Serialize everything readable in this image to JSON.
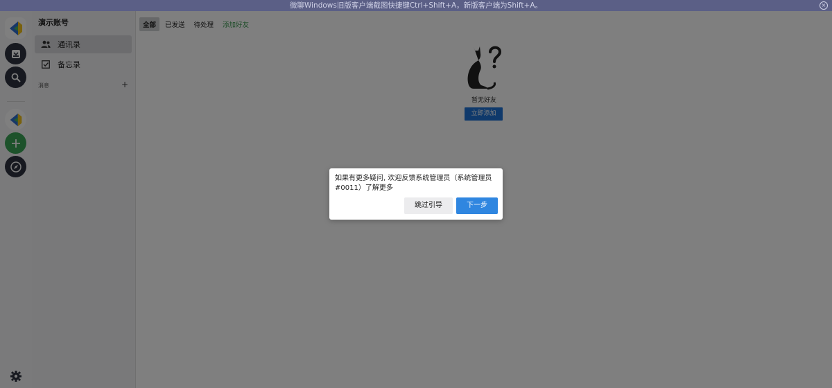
{
  "banner": {
    "text": "微聊Windows旧版客户端截图快捷键Ctrl+Shift+A，新版客户端为Shift+A。",
    "close_icon": "close-icon"
  },
  "rail": {
    "items": [
      {
        "name": "app-logo",
        "icon": "app-logo-icon"
      },
      {
        "name": "inbox",
        "icon": "inbox-icon"
      },
      {
        "name": "search",
        "icon": "search-icon"
      },
      {
        "name": "workspace",
        "icon": "app-logo-icon"
      },
      {
        "name": "add",
        "icon": "plus-icon"
      },
      {
        "name": "discover",
        "icon": "compass-icon"
      },
      {
        "name": "settings",
        "icon": "gear-icon"
      }
    ],
    "colors": {
      "dark_button": "#2f3340",
      "green_button": "#3aa557"
    }
  },
  "panel": {
    "account_title": "演示账号",
    "nav": [
      {
        "label": "通讯录",
        "icon": "contacts-icon",
        "active": true
      },
      {
        "label": "备忘录",
        "icon": "checkbox-icon",
        "active": false
      }
    ],
    "section_label": "消息",
    "section_add": "+"
  },
  "main": {
    "tabs": [
      {
        "label": "全部",
        "active": true
      },
      {
        "label": "已发送",
        "active": false
      },
      {
        "label": "待处理",
        "active": false
      },
      {
        "label": "添加好友",
        "link": true
      }
    ],
    "empty_text": "暂无好友",
    "add_now_label": "立即添加"
  },
  "dialog": {
    "message": "如果有更多疑问, 欢迎反馈系统管理员（系统管理员#0011）了解更多",
    "skip_label": "跳过引导",
    "next_label": "下一步"
  },
  "colors": {
    "accent_blue": "#2f86e0",
    "add_now_blue": "#1f73d6",
    "link_green": "#3d9a53"
  }
}
